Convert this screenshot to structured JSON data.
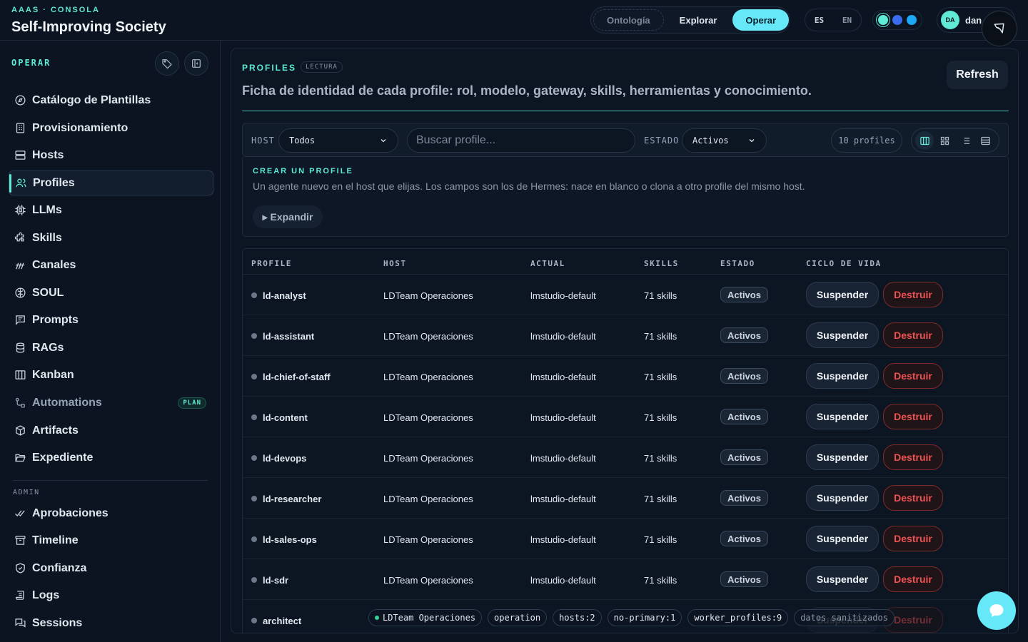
{
  "header": {
    "kicker": "AAAS · CONSOLA",
    "title": "Self-Improving Society",
    "modes": [
      "Ontología",
      "Explorar",
      "Operar"
    ],
    "active_mode": "Operar",
    "languages": [
      "ES",
      "EN"
    ],
    "theme_dots": [
      "#5eead4",
      "#3b6cf0",
      "#1ea7f5"
    ],
    "user_initials": "DA",
    "user_name": "dan"
  },
  "sidebar": {
    "section": "OPERAR",
    "items": [
      {
        "label": "Catálogo de Plantillas",
        "icon": "compass-icon"
      },
      {
        "label": "Provisionamiento",
        "icon": "building-icon"
      },
      {
        "label": "Hosts",
        "icon": "server-icon"
      },
      {
        "label": "Profiles",
        "icon": "users-icon"
      },
      {
        "label": "LLMs",
        "icon": "cpu-icon"
      },
      {
        "label": "Skills",
        "icon": "puzzle-icon"
      },
      {
        "label": "Canales",
        "icon": "signal-icon"
      },
      {
        "label": "SOUL",
        "icon": "brain-icon"
      },
      {
        "label": "Prompts",
        "icon": "message-square-icon"
      },
      {
        "label": "RAGs",
        "icon": "database-icon"
      },
      {
        "label": "Kanban",
        "icon": "kanban-icon"
      },
      {
        "label": "Automations",
        "icon": "workflow-icon",
        "badge": "PLAN"
      },
      {
        "label": "Artifacts",
        "icon": "package-icon"
      },
      {
        "label": "Expediente",
        "icon": "folder-open-icon"
      }
    ],
    "active": "Profiles",
    "admin_section": "ADMIN",
    "admin_items": [
      {
        "label": "Aprobaciones",
        "icon": "check-check-icon"
      },
      {
        "label": "Timeline",
        "icon": "archive-icon"
      },
      {
        "label": "Confianza",
        "icon": "shield-check-icon"
      },
      {
        "label": "Logs",
        "icon": "scroll-text-icon"
      },
      {
        "label": "Sessions",
        "icon": "messages-icon"
      }
    ]
  },
  "main": {
    "kicker": "PROFILES",
    "tag": "LECTURA",
    "subtitle": "Ficha de identidad de cada profile: rol, modelo, gateway, skills, herramientas y conocimiento.",
    "refresh_label": "Refresh",
    "filters": {
      "host_label": "HOST",
      "host_value": "Todos",
      "search_placeholder": "Buscar profile...",
      "estado_label": "ESTADO",
      "estado_value": "Activos",
      "count": "10 profiles"
    },
    "create": {
      "kicker": "CREAR UN PROFILE",
      "text": "Un agente nuevo en el host que elijas. Los campos son los de Hermes: nace en blanco o clona a otro profile del mismo host.",
      "expand_label": "▸ Expandir"
    },
    "table": {
      "columns": [
        "PROFILE",
        "HOST",
        "ACTUAL",
        "SKILLS",
        "ESTADO",
        "CICLO DE VIDA"
      ],
      "suspend_label": "Suspender",
      "destroy_label": "Destruir",
      "rows": [
        {
          "profile": "ld-analyst",
          "host": "LDTeam Operaciones",
          "actual": "lmstudio-default",
          "skills": "71 skills",
          "estado": "Activos"
        },
        {
          "profile": "ld-assistant",
          "host": "LDTeam Operaciones",
          "actual": "lmstudio-default",
          "skills": "71 skills",
          "estado": "Activos"
        },
        {
          "profile": "ld-chief-of-staff",
          "host": "LDTeam Operaciones",
          "actual": "lmstudio-default",
          "skills": "71 skills",
          "estado": "Activos"
        },
        {
          "profile": "ld-content",
          "host": "LDTeam Operaciones",
          "actual": "lmstudio-default",
          "skills": "71 skills",
          "estado": "Activos"
        },
        {
          "profile": "ld-devops",
          "host": "LDTeam Operaciones",
          "actual": "lmstudio-default",
          "skills": "71 skills",
          "estado": "Activos"
        },
        {
          "profile": "ld-researcher",
          "host": "LDTeam Operaciones",
          "actual": "lmstudio-default",
          "skills": "71 skills",
          "estado": "Activos"
        },
        {
          "profile": "ld-sales-ops",
          "host": "LDTeam Operaciones",
          "actual": "lmstudio-default",
          "skills": "71 skills",
          "estado": "Activos"
        },
        {
          "profile": "ld-sdr",
          "host": "LDTeam Operaciones",
          "actual": "lmstudio-default",
          "skills": "71 skills",
          "estado": "Activos"
        },
        {
          "profile": "architect",
          "host": "",
          "actual": "",
          "skills": "",
          "estado": ""
        }
      ]
    }
  },
  "statusbar": {
    "chips": [
      "LDTeam Operaciones",
      "operation",
      "hosts:2",
      "no-primary:1",
      "worker_profiles:9",
      "datos sanitizados"
    ]
  }
}
